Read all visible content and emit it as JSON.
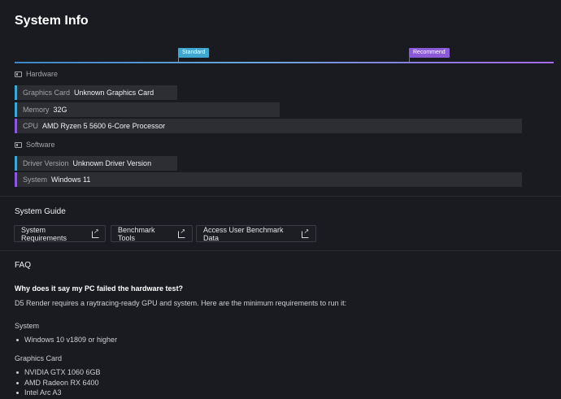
{
  "title": "System Info",
  "scale": {
    "standard_label": "Standard",
    "recommend_label": "Recommend"
  },
  "hardware": {
    "label": "Hardware",
    "items": [
      {
        "key": "Graphics Card",
        "value": "Unknown Graphics Card"
      },
      {
        "key": "Memory",
        "value": "32G"
      },
      {
        "key": "CPU",
        "value": "AMD Ryzen 5 5600 6-Core Processor"
      }
    ]
  },
  "software": {
    "label": "Software",
    "items": [
      {
        "key": "Driver Version",
        "value": "Unknown Driver Version"
      },
      {
        "key": "System",
        "value": "Windows 11"
      }
    ]
  },
  "guide": {
    "title": "System Guide",
    "buttons": [
      "System Requirements",
      "Benchmark Tools",
      "Access User Benchmark Data"
    ]
  },
  "faq": {
    "title": "FAQ",
    "question": "Why does it say my PC failed the hardware test?",
    "answer": "D5 Render requires a raytracing-ready GPU and system. Here are the minimum requirements to run it:",
    "system_heading": "System",
    "system_items": [
      "Windows 10 v1809 or higher"
    ],
    "gpu_heading": "Graphics Card",
    "gpu_items": [
      "NVIDIA GTX 1060 6GB",
      "AMD Radeon RX 6400",
      "Intel Arc A3"
    ]
  },
  "colors": {
    "standard": "#3ea6cf",
    "recommend": "#8a5ad8",
    "background": "#1a1b20"
  }
}
